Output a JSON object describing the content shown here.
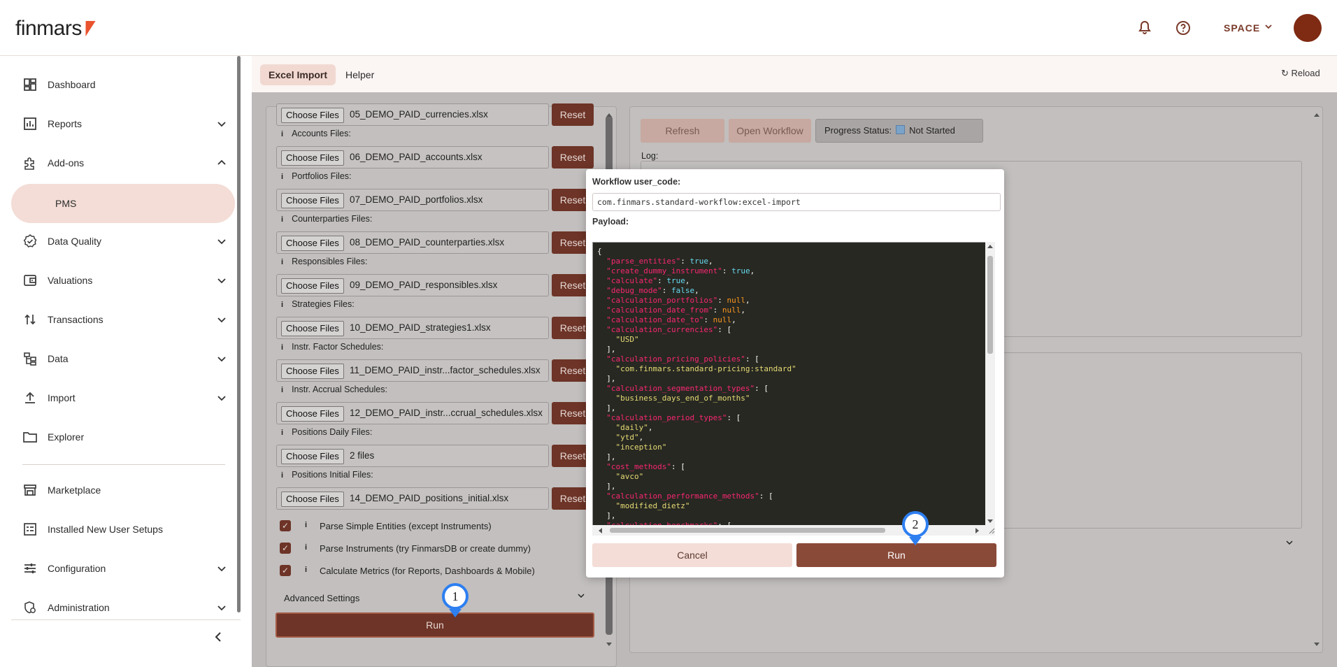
{
  "header": {
    "logo": "finmars",
    "space_label": "SPACE"
  },
  "sidebar": {
    "items": [
      {
        "label": "Dashboard"
      },
      {
        "label": "Reports"
      },
      {
        "label": "Add-ons"
      },
      {
        "label": "PMS"
      },
      {
        "label": "Data Quality"
      },
      {
        "label": "Valuations"
      },
      {
        "label": "Transactions"
      },
      {
        "label": "Data"
      },
      {
        "label": "Import"
      },
      {
        "label": "Explorer"
      },
      {
        "label": "Marketplace"
      },
      {
        "label": "Installed New User Setups"
      },
      {
        "label": "Configuration"
      },
      {
        "label": "Administration"
      }
    ]
  },
  "tabs": [
    {
      "label": "Excel Import",
      "active": true
    },
    {
      "label": "Helper",
      "active": false
    }
  ],
  "reload_label": "↻ Reload",
  "import": {
    "choose_label": "Choose Files",
    "reset_label": "Reset",
    "rows": [
      {
        "file": "05_DEMO_PAID_currencies.xlsx"
      },
      {
        "group": "Accounts Files:",
        "file": "06_DEMO_PAID_accounts.xlsx"
      },
      {
        "group": "Portfolios Files:",
        "file": "07_DEMO_PAID_portfolios.xlsx"
      },
      {
        "group": "Counterparties Files:",
        "file": "08_DEMO_PAID_counterparties.xlsx"
      },
      {
        "group": "Responsibles Files:",
        "file": "09_DEMO_PAID_responsibles.xlsx"
      },
      {
        "group": "Strategies Files:",
        "file": "10_DEMO_PAID_strategies1.xlsx"
      },
      {
        "group": "Instr. Factor Schedules:",
        "file": "11_DEMO_PAID_instr...factor_schedules.xlsx"
      },
      {
        "group": "Instr. Accrual Schedules:",
        "file": "12_DEMO_PAID_instr...ccrual_schedules.xlsx"
      },
      {
        "group": "Positions Daily Files:",
        "file": "2 files"
      },
      {
        "group": "Positions Initial Files:",
        "file": "14_DEMO_PAID_positions_initial.xlsx"
      }
    ],
    "checks": [
      {
        "label": "Parse Simple Entities (except Instruments)",
        "checked": true
      },
      {
        "label": "Parse Instruments (try FinmarsDB or create dummy)",
        "checked": true
      },
      {
        "label": "Calculate Metrics (for Reports, Dashboards & Mobile)",
        "checked": true
      }
    ],
    "advanced_label": "Advanced Settings",
    "run_label": "Run"
  },
  "workflow_panel": {
    "refresh_label": "Refresh",
    "open_workflow_label": "Open Workflow",
    "progress_label": "Progress Status:",
    "progress_value": "Not Started",
    "log_label": "Log:"
  },
  "modal": {
    "user_code_label": "Workflow user_code:",
    "user_code_value": "com.finmars.standard-workflow:excel-import",
    "payload_label": "Payload:",
    "cancel_label": "Cancel",
    "run_label": "Run"
  },
  "markers": [
    {
      "number": "1"
    },
    {
      "number": "2"
    }
  ],
  "colors": {
    "brand": "#7f2a12",
    "primary_button": "#8a4a38",
    "accent_marker": "#2e7ff0"
  }
}
